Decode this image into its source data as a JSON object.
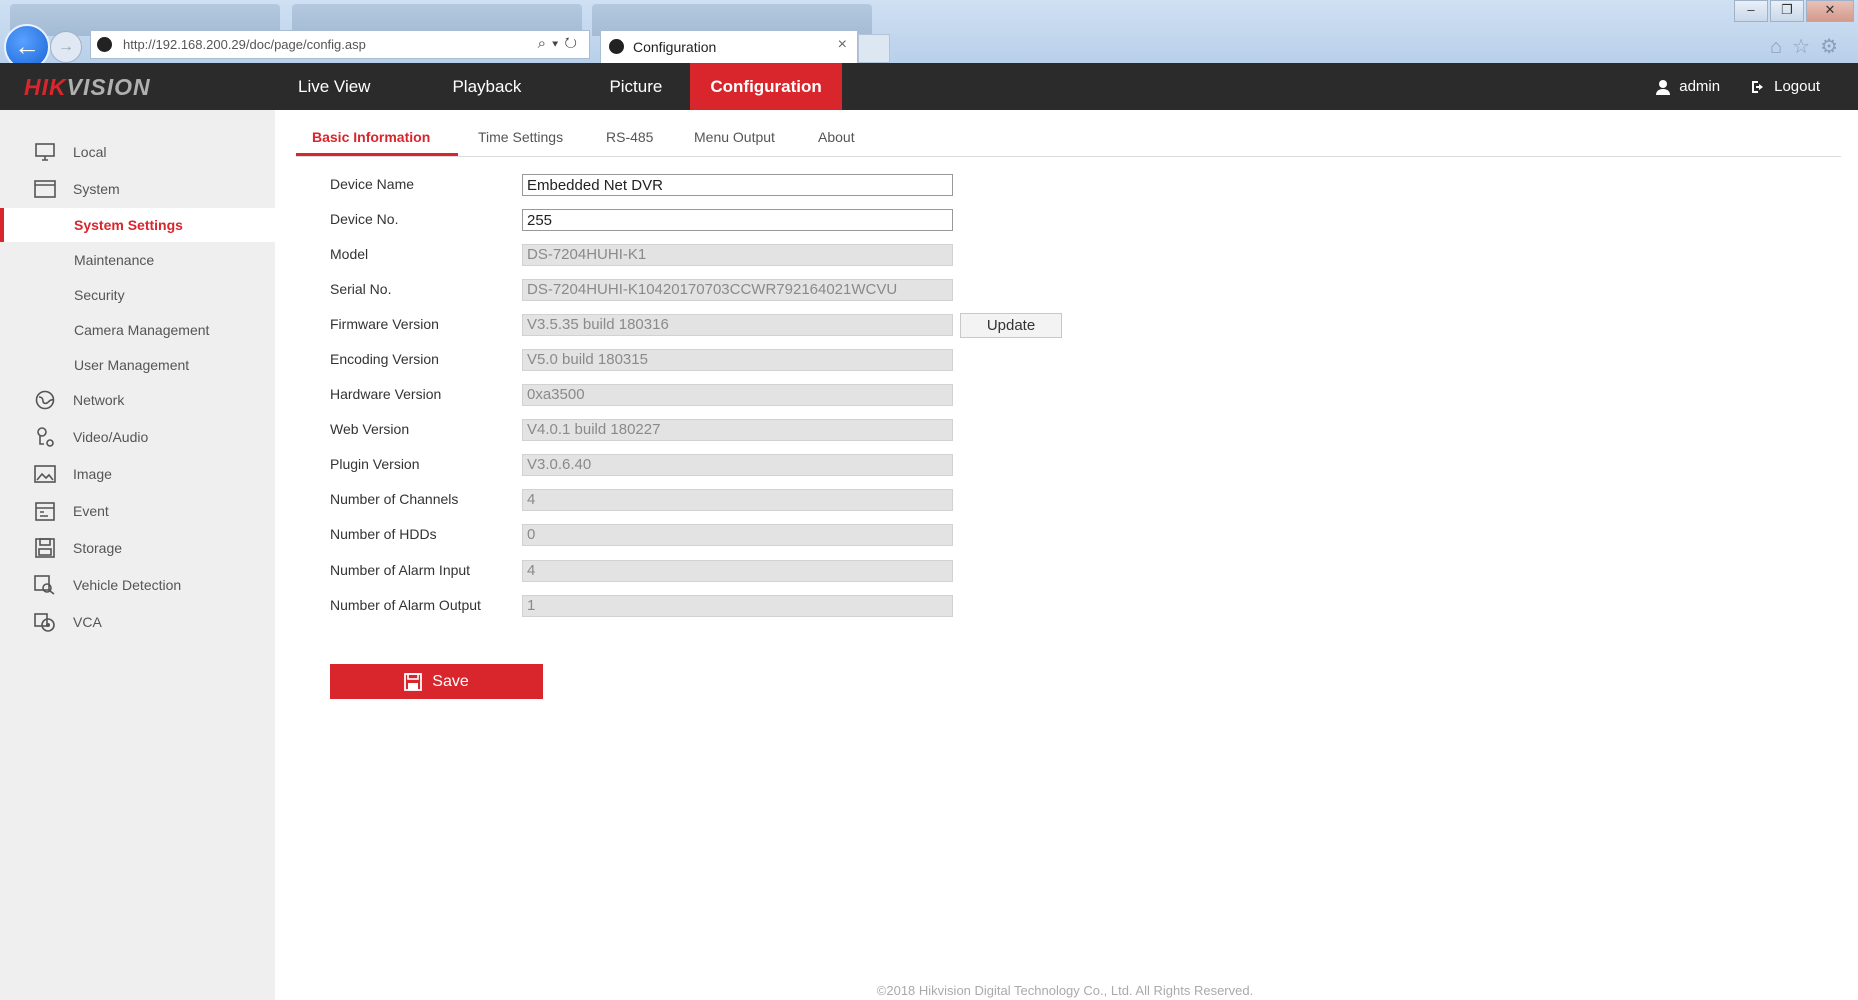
{
  "browser": {
    "url": "http://192.168.200.29/doc/page/config.asp",
    "tab_title": "Configuration",
    "tab_close": "×"
  },
  "header": {
    "logo_hik": "HIK",
    "logo_vision": "VISION",
    "nav": [
      "Live View",
      "Playback",
      "Picture",
      "Configuration"
    ],
    "active_nav": "Configuration",
    "user": "admin",
    "logout": "Logout"
  },
  "sidebar": {
    "items": [
      {
        "label": "Local",
        "icon": "monitor-icon"
      },
      {
        "label": "System",
        "icon": "system-window-icon"
      },
      {
        "label": "System Settings",
        "sub": true,
        "active": true
      },
      {
        "label": "Maintenance",
        "sub": true
      },
      {
        "label": "Security",
        "sub": true
      },
      {
        "label": "Camera Management",
        "sub": true
      },
      {
        "label": "User Management",
        "sub": true
      },
      {
        "label": "Network",
        "icon": "globe-icon"
      },
      {
        "label": "Video/Audio",
        "icon": "video-audio-icon"
      },
      {
        "label": "Image",
        "icon": "image-icon"
      },
      {
        "label": "Event",
        "icon": "calendar-icon"
      },
      {
        "label": "Storage",
        "icon": "storage-icon"
      },
      {
        "label": "Vehicle Detection",
        "icon": "vehicle-icon"
      },
      {
        "label": "VCA",
        "icon": "vca-icon"
      }
    ]
  },
  "tabs": [
    "Basic Information",
    "Time Settings",
    "RS-485",
    "Menu Output",
    "About"
  ],
  "active_tab": "Basic Information",
  "form": {
    "fields": [
      {
        "label": "Device Name",
        "value": "Embedded Net DVR",
        "editable": true
      },
      {
        "label": "Device No.",
        "value": "255",
        "editable": true
      },
      {
        "label": "Model",
        "value": "DS-7204HUHI-K1",
        "editable": false
      },
      {
        "label": "Serial No.",
        "value": "DS-7204HUHI-K10420170703CCWR792164021WCVU",
        "editable": false
      },
      {
        "label": "Firmware Version",
        "value": "V3.5.35 build 180316",
        "editable": false
      },
      {
        "label": "Encoding Version",
        "value": "V5.0 build 180315",
        "editable": false
      },
      {
        "label": "Hardware Version",
        "value": "0xa3500",
        "editable": false
      },
      {
        "label": "Web Version",
        "value": "V4.0.1 build 180227",
        "editable": false
      },
      {
        "label": "Plugin Version",
        "value": "V3.0.6.40",
        "editable": false
      },
      {
        "label": "Number of Channels",
        "value": "4",
        "editable": false
      },
      {
        "label": "Number of HDDs",
        "value": "0",
        "editable": false
      },
      {
        "label": "Number of Alarm Input",
        "value": "4",
        "editable": false
      },
      {
        "label": "Number of Alarm Output",
        "value": "1",
        "editable": false
      }
    ],
    "update_label": "Update",
    "save_label": "Save"
  },
  "footer": "©2018 Hikvision Digital Technology Co., Ltd. All Rights Reserved.",
  "colors": {
    "accent": "#d8262c",
    "header_bg": "#2b2b2b",
    "sidebar_bg": "#efefef"
  }
}
